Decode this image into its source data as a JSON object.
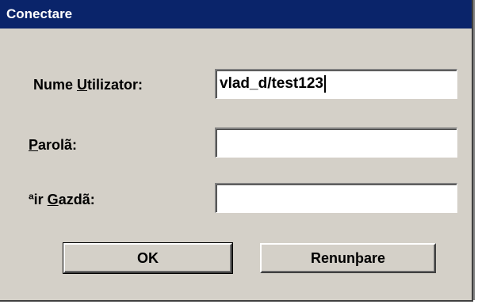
{
  "window": {
    "title": "Conectare"
  },
  "form": {
    "username": {
      "label_before": "Nume ",
      "label_accel": "U",
      "label_after": "tilizator:",
      "value": "vlad_d/test123"
    },
    "password": {
      "label_before": "",
      "label_accel": "P",
      "label_after": "arolã:",
      "value": ""
    },
    "host_string": {
      "label_before": "ªir ",
      "label_accel": "G",
      "label_after": "azdã:",
      "value": ""
    }
  },
  "buttons": {
    "ok_label": "OK",
    "cancel_label": "Renunþare"
  },
  "colors": {
    "titlebar": "#0a246a",
    "dialog_bg": "#d4d0c8"
  }
}
